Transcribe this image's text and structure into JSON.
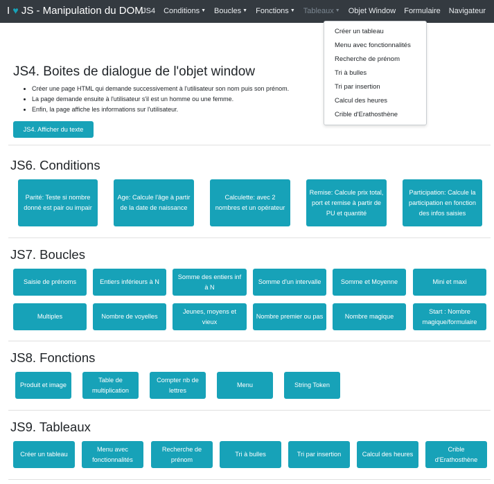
{
  "navbar": {
    "brand_prefix": "I",
    "brand_title": "JS - Manipulation du DOM",
    "items": [
      {
        "label": "JS4"
      },
      {
        "label": "Conditions"
      },
      {
        "label": "Boucles"
      },
      {
        "label": "Fonctions"
      },
      {
        "label": "Tableaux"
      },
      {
        "label": "Objet Window"
      },
      {
        "label": "Formulaire"
      },
      {
        "label": "Navigateur"
      }
    ]
  },
  "dropdown": {
    "items": [
      {
        "label": "Créer un tableau"
      },
      {
        "label": "Menu avec fonctionnalités"
      },
      {
        "label": "Recherche de prénom"
      },
      {
        "label": "Tri à bulles"
      },
      {
        "label": "Tri par insertion"
      },
      {
        "label": "Calcul des heures"
      },
      {
        "label": "Crible d'Erathosthène"
      }
    ]
  },
  "js4": {
    "title": "JS4. Boites de dialogue de l'objet window",
    "bullets": [
      "Créer une page HTML qui demande successivement à l'utilisateur son nom puis son prénom.",
      "La page demande ensuite à l'utilisateur s'il est un homme ou une femme.",
      "Enfin, la page affiche les informations sur l'utilisateur."
    ],
    "button": "JS4. Afficher du texte"
  },
  "js6": {
    "title": "JS6. Conditions",
    "buttons": [
      "Parité: Teste si nombre donné est pair ou impair",
      "Age: Calcule l'âge à partir de la date de naissance",
      "Calculette: avec 2 nombres et un opérateur",
      "Remise: Calcule prix total, port et remise à partir de PU et quantité",
      "Participation: Calcule la participation en fonction des infos saisies"
    ]
  },
  "js7": {
    "title": "JS7. Boucles",
    "buttons": [
      "Saisie de prénoms",
      "Entiers inférieurs à N",
      "Somme des entiers inf à N",
      "Somme d'un intervalle",
      "Somme et Moyenne",
      "Mini et maxi",
      "Multiples",
      "Nombre de voyelles",
      "Jeunes, moyens et vieux",
      "Nombre premier ou pas",
      "Nombre magique",
      "Start : Nombre magique/formulaire"
    ]
  },
  "js8": {
    "title": "JS8. Fonctions",
    "buttons": [
      "Produit et image",
      "Table de multiplication",
      "Compter nb de lettres",
      "Menu",
      "String Token"
    ]
  },
  "js9": {
    "title": "JS9. Tableaux",
    "buttons": [
      "Créer un tableau",
      "Menu avec fonctionnalités",
      "Recherche de prénom",
      "Tri à bulles",
      "Tri par insertion",
      "Calcul des heures",
      "Crible d'Erathosthène"
    ]
  },
  "colors": {
    "navbar_bg": "#343a40",
    "accent": "#17a2b8",
    "button_text": "#ffffff"
  }
}
